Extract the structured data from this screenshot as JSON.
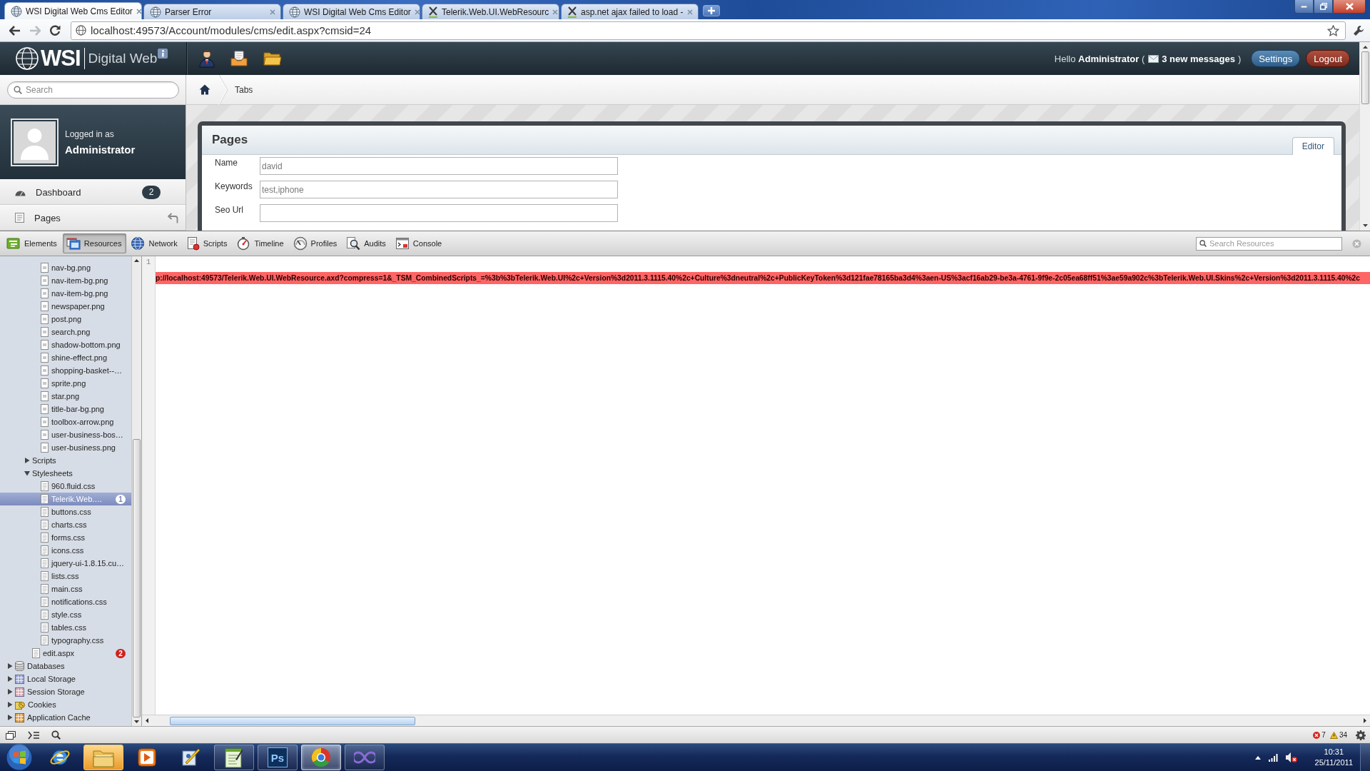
{
  "browser": {
    "tabs": [
      {
        "title": "WSI Digital Web Cms Editor",
        "kind": "globe",
        "selected": true
      },
      {
        "title": "Parser Error",
        "kind": "globe",
        "selected": false
      },
      {
        "title": "WSI Digital Web Cms Editor",
        "kind": "globe",
        "selected": false
      },
      {
        "title": "Telerik.Web.UI.WebResourc",
        "kind": "cross",
        "selected": false
      },
      {
        "title": "asp.net ajax failed to load -",
        "kind": "cross",
        "selected": false
      }
    ],
    "navigation": [
      {
        "kind": "back",
        "disabled": false
      },
      {
        "kind": "forward",
        "disabled": true
      },
      {
        "kind": "reload",
        "disabled": false
      }
    ],
    "address": {
      "url": "localhost:49573/Account/modules/cms/edit.aspx?cmsid=24"
    }
  },
  "app_header": {
    "brand": {
      "mark": "WSI",
      "product": "Digital Web"
    },
    "greeting": "Hello **Administrator** (",
    "messages_link": "3 new messages",
    "greeting_end": ")",
    "buttons": [
      {
        "label": "Settings",
        "kind": "settings"
      },
      {
        "label": "Logout",
        "kind": "logout"
      }
    ]
  },
  "sidebar": {
    "search": {
      "placeholder": "Search"
    },
    "user": {
      "caption": "Logged in as",
      "name": "Administrator"
    },
    "nav": [
      {
        "label": "Dashboard",
        "kind": "dashboard",
        "badge": "2"
      },
      {
        "label": "Pages",
        "kind": "pages"
      }
    ]
  },
  "breadcrumb": [
    "Tabs"
  ],
  "panel": {
    "title": "Pages",
    "tabs": [
      {
        "label": "Editor",
        "selected": true
      }
    ],
    "fields": [
      {
        "label": "Name",
        "value": "david"
      },
      {
        "label": "Keywords",
        "value": "test,iphone"
      },
      {
        "label": "Seo Url"
      }
    ]
  },
  "devtools": {
    "tabs": [
      {
        "label": "Elements",
        "kind": "elements",
        "selected": false
      },
      {
        "label": "Resources",
        "kind": "resources",
        "selected": true
      },
      {
        "label": "Network",
        "kind": "network",
        "selected": false
      },
      {
        "label": "Scripts",
        "kind": "scripts",
        "selected": false
      },
      {
        "label": "Timeline",
        "kind": "timeline",
        "selected": false
      },
      {
        "label": "Profiles",
        "kind": "profiles",
        "selected": false
      },
      {
        "label": "Audits",
        "kind": "audits",
        "selected": false
      },
      {
        "label": "Console",
        "kind": "console",
        "selected": false
      }
    ],
    "search": {
      "placeholder": "Search Resources"
    },
    "resource_tree": [
      {
        "children": [
          {
            "children": [
              {
                "children": [
                  {
                    "label": "nav-bg.png",
                    "kind": "image",
                    "selected": false
                  },
                  {
                    "label": "nav-item-bg.png",
                    "kind": "image",
                    "selected": false
                  },
                  {
                    "label": "nav-item-bg.png",
                    "kind": "image",
                    "selected": false
                  },
                  {
                    "label": "newspaper.png",
                    "kind": "image",
                    "selected": false
                  },
                  {
                    "label": "post.png",
                    "kind": "image",
                    "selected": false
                  },
                  {
                    "label": "search.png",
                    "kind": "image",
                    "selected": false
                  },
                  {
                    "label": "shadow-bottom.png",
                    "kind": "image",
                    "selected": false
                  },
                  {
                    "label": "shine-effect.png",
                    "kind": "image",
                    "selected": false
                  },
                  {
                    "label": "shopping-basket--…",
                    "kind": "image",
                    "selected": false
                  },
                  {
                    "label": "sprite.png",
                    "kind": "image",
                    "selected": false
                  },
                  {
                    "label": "star.png",
                    "kind": "image",
                    "selected": false
                  },
                  {
                    "label": "title-bar-bg.png",
                    "kind": "image",
                    "selected": false
                  },
                  {
                    "label": "toolbox-arrow.png",
                    "kind": "image",
                    "selected": false
                  },
                  {
                    "label": "user-business-bos…",
                    "kind": "image",
                    "selected": false
                  },
                  {
                    "label": "user-business.png",
                    "kind": "image",
                    "selected": false
                  }
                ]
              },
              {
                "label": "Scripts",
                "kind": "folder",
                "expanded": false,
                "selected": false
              },
              {
                "label": "Stylesheets",
                "kind": "folder",
                "expanded": true,
                "selected": false,
                "children": [
                  {
                    "label": "960.fluid.css",
                    "kind": "stylesheet",
                    "selected": false
                  },
                  {
                    "label": "Telerik.Web.…",
                    "kind": "stylesheet",
                    "selected": true,
                    "badge": "1"
                  },
                  {
                    "label": "buttons.css",
                    "kind": "stylesheet",
                    "selected": false
                  },
                  {
                    "label": "charts.css",
                    "kind": "stylesheet",
                    "selected": false
                  },
                  {
                    "label": "forms.css",
                    "kind": "stylesheet",
                    "selected": false
                  },
                  {
                    "label": "icons.css",
                    "kind": "stylesheet",
                    "selected": false
                  },
                  {
                    "label": "jquery-ui-1.8.15.cu…",
                    "kind": "stylesheet",
                    "selected": false
                  },
                  {
                    "label": "lists.css",
                    "kind": "stylesheet",
                    "selected": false
                  },
                  {
                    "label": "main.css",
                    "kind": "stylesheet",
                    "selected": false
                  },
                  {
                    "label": "notifications.css",
                    "kind": "stylesheet",
                    "selected": false
                  },
                  {
                    "label": "style.css",
                    "kind": "stylesheet",
                    "selected": false
                  },
                  {
                    "label": "tables.css",
                    "kind": "stylesheet",
                    "selected": false
                  },
                  {
                    "label": "typography.css",
                    "kind": "stylesheet",
                    "selected": false
                  }
                ]
              },
              {
                "label": "edit.aspx",
                "kind": "document",
                "selected": false,
                "badge": "2"
              }
            ]
          }
        ]
      },
      {
        "label": "Databases",
        "kind": "database",
        "expanded": false,
        "selected": false
      },
      {
        "label": "Local Storage",
        "kind": "local-storage",
        "expanded": false,
        "selected": false
      },
      {
        "label": "Session Storage",
        "kind": "session-storage",
        "expanded": false,
        "selected": false
      },
      {
        "label": "Cookies",
        "kind": "cookies",
        "expanded": false,
        "selected": false
      },
      {
        "label": "Application Cache",
        "kind": "app-cache",
        "expanded": false,
        "selected": false
      }
    ],
    "source": {
      "line_numbers": [
        "1"
      ],
      "error_message": "p://localhost:49573/Telerik.Web.UI.WebResource.axd?compress=1&_TSM_CombinedScripts_=%3b%3bTelerik.Web.UI%2c+Version%3d2011.3.1115.40%2c+Culture%3dneutral%2c+PublicKeyToken%3d121fae78165ba3d4%3aen-US%3acf16ab29-be3a-4761-9f9e-2c05ea68ff51%3ae59a902c%3bTelerik.Web.UI.Skins%2c+Version%3d2011.3.1115.40%2c"
    },
    "status": {
      "errors": "7",
      "warnings": "34"
    }
  },
  "taskbar": {
    "apps": [
      {
        "kind": "ie",
        "running": false,
        "selected": false,
        "highlighted": false
      },
      {
        "kind": "explorer",
        "running": false,
        "selected": false,
        "highlighted": true
      },
      {
        "kind": "media",
        "running": false,
        "selected": false,
        "highlighted": false
      },
      {
        "kind": "pen",
        "running": false,
        "selected": false,
        "highlighted": false
      },
      {
        "kind": "notepad",
        "running": true,
        "selected": false,
        "highlighted": false
      },
      {
        "kind": "photoshop",
        "glyph": "Ps",
        "running": true,
        "selected": false,
        "highlighted": false
      },
      {
        "kind": "chrome",
        "running": true,
        "selected": true,
        "highlighted": false
      },
      {
        "kind": "infinity",
        "running": true,
        "selected": false,
        "highlighted": false
      }
    ],
    "clock": {
      "time": "10:31",
      "date": "25/11/2011"
    }
  }
}
